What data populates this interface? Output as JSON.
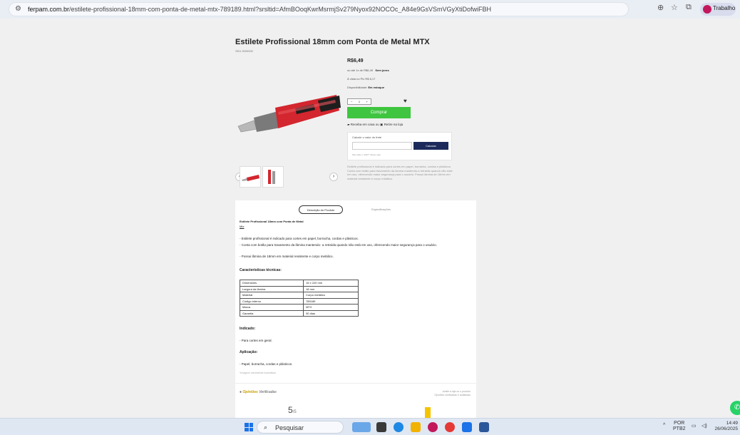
{
  "browser": {
    "domain": "ferpam.com.br",
    "url_path": "/estilete-profissional-18mm-com-ponta-de-metal-mtx-789189.html?srsltid=AfmBOoqKwrMsrmjSv279Nyox92NOCOc_A84e9GsVSmVGyXtiDofwiFBH",
    "profile_label": "Trabalho",
    "icons": [
      "site-settings-icon",
      "zoom-icon",
      "star-icon",
      "extensions-icon"
    ]
  },
  "product": {
    "title": "Estilete Profissional 18mm com Ponta de Metal MTX",
    "sku": "SKU 0000000",
    "price": "R$6,49",
    "installments_prefix": "ou até 1x de R$6,49",
    "installments_suffix": "Sem juros",
    "pix": "À vista no Pix R$ 6,17",
    "availability_label": "Disponibilidade:",
    "availability_value": "Em estoque",
    "qty_minus": "−",
    "qty_value": "1",
    "qty_plus": "+",
    "buy_button": "Comprar",
    "pickup_text": "Receba em casa ou",
    "pickup_store": "Retire na loja",
    "shipping_label": "Calcule o valor do frete",
    "cep_button": "Calcular",
    "cep_help": "Não sabe o CEP? Clique aqui",
    "short_description": "Estilete profissional é indicado para cortes em papel, borracha, cordas e plásticos. Conta com botão para travamento da lâmina mantendo-a retraída quando não está em uso, oferecendo maior segurança para o usuário. Possui lâmina de 18mm em material resistente e corpo metálico."
  },
  "tabs": {
    "active": "Descrição do Produto",
    "other": "Especificações"
  },
  "description": {
    "heading": "Estilete Profissional 18mm com Ponta de Metal",
    "brand": "Mtx",
    "p1": "- Estilete profissional é indicado para cortes em papel, borracha, cordas e plásticos.",
    "p2": "- Conta com botão para travamento da lâmina mantendo- a retraída quando não está em uso, oferecendo maior segurança para o usuário.",
    "p3": "- Possui lâmina de 18mm em material resistente e corpo metálico.",
    "tech_title": "Características técnicas:",
    "specs": [
      {
        "label": "Dimensões",
        "value": "15 x 220 mm"
      },
      {
        "label": "Largura da lâmina",
        "value": "18 mm"
      },
      {
        "label": "Material",
        "value": "Corpo metálico"
      },
      {
        "label": "Código interno",
        "value": "789189"
      },
      {
        "label": "Marca",
        "value": "MTX"
      },
      {
        "label": "Garantia",
        "value": "90 dias"
      }
    ],
    "indicated_title": "Indicado:",
    "indicated_text": "- Para cortes em geral.",
    "application_title": "Aplicação:",
    "application_text": "- Papel, borracha, cordas e plásticos.",
    "note": "*Imagens meramente ilustrativas"
  },
  "reviews": {
    "brand_prefix": "Opiniões",
    "brand_name": "Verificadas",
    "link_line1": "Avalie a loja ou o produto",
    "link_line2": "Opiniões verificadas e auditadas",
    "score": "5",
    "score_max": "/5",
    "bar_color": "#f5c400"
  },
  "taskbar": {
    "search_placeholder": "Pesquisar",
    "lang_top": "POR",
    "lang_bottom": "PTB2",
    "time": "14:49",
    "date": "26/06/2025"
  },
  "colors": {
    "buy_green": "#3fc53f",
    "calc_navy": "#1b2a5a",
    "knife_red": "#d3262e"
  }
}
